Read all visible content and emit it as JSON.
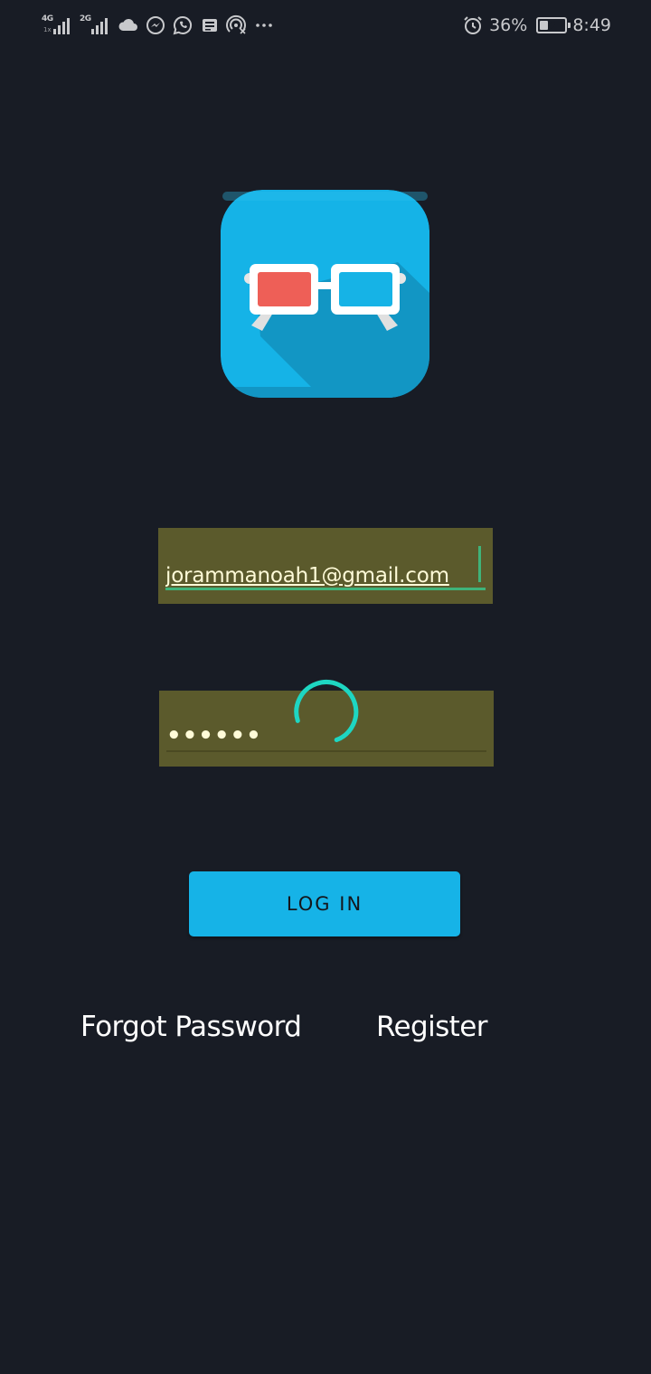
{
  "status_bar": {
    "network_1": "4G",
    "network_1_sub": "1x",
    "network_2": "2G",
    "left_icons": [
      "cloud-icon",
      "messenger-icon",
      "whatsapp-icon",
      "news-icon",
      "hotspot-icon",
      "more-dots-icon"
    ],
    "battery_percent": "36%",
    "battery_level": 0.36,
    "time": "8:49",
    "right_icons": [
      "alarm-icon",
      "battery-saver-icon"
    ]
  },
  "logo": {
    "icon": "3d-glasses-logo",
    "colors": {
      "background": "#15b3e7",
      "shadow": "#1296c4",
      "left_lens": "#ee5f57",
      "right_lens": "#16b3e6",
      "frame": "#ffffff"
    }
  },
  "login_form": {
    "email_value": "jorammanoah1@gmail.com",
    "password_value": "••••••",
    "login_button_label": "LOG IN",
    "forgot_password_label": "Forgot Password",
    "register_label": "Register"
  },
  "loading": {
    "icon": "loading-spinner",
    "color": "#1ed6c2"
  },
  "colors": {
    "background": "#181c25",
    "field_background": "#5b5a2c",
    "field_text": "#fffbd8",
    "focus_underline": "#3fb37a",
    "button": "#16b3e7"
  }
}
